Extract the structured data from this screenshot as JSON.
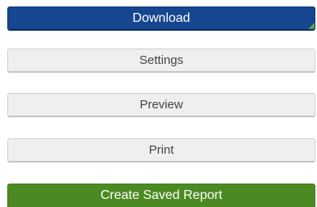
{
  "actions": {
    "download_label": "Download",
    "settings_label": "Settings",
    "preview_label": "Preview",
    "print_label": "Print",
    "create_saved_report_label": "Create Saved Report"
  },
  "colors": {
    "primary": "#16468f",
    "secondary_bg": "#efefef",
    "success": "#4b8a22",
    "corner_accent": "#5fa238"
  }
}
